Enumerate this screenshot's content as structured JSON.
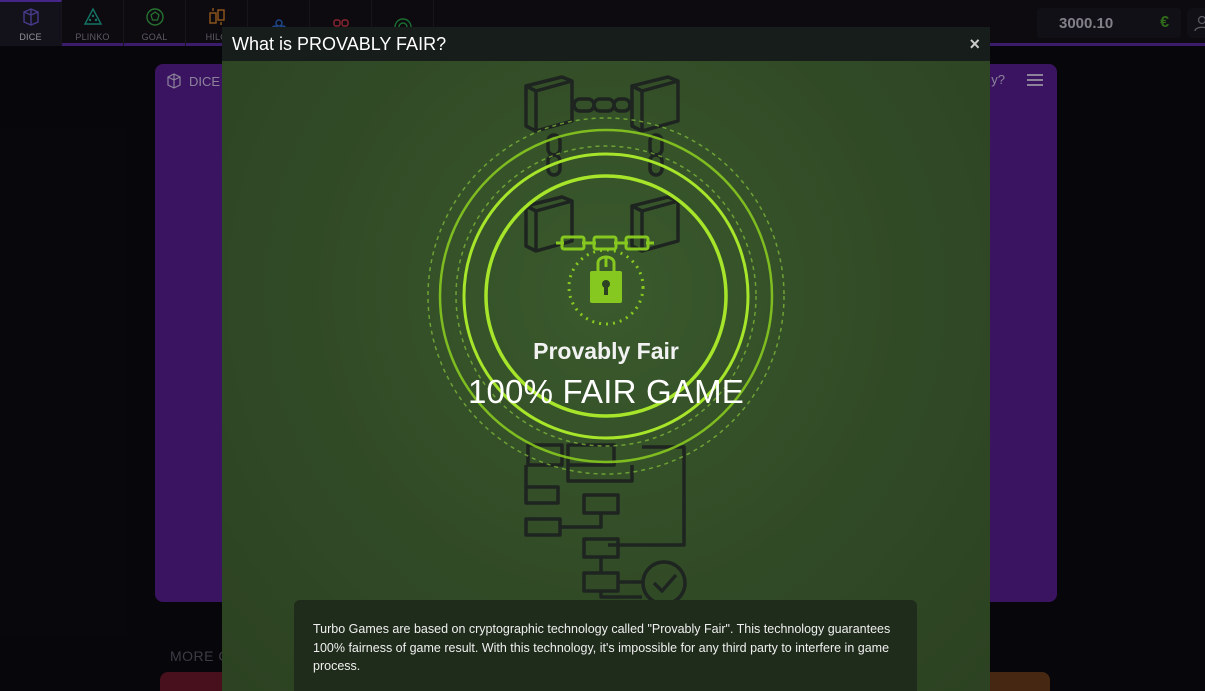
{
  "nav": {
    "items": [
      {
        "label": "DICE",
        "icon": "dice-icon",
        "color": "#6b5bd6",
        "active": true
      },
      {
        "label": "PLINKO",
        "icon": "plinko-icon",
        "color": "#1fb39a",
        "active": false
      },
      {
        "label": "GOAL",
        "icon": "goal-icon",
        "color": "#3bb04a",
        "active": false
      },
      {
        "label": "HILO",
        "icon": "hilo-icon",
        "color": "#e0862a",
        "active": false
      },
      {
        "label": "",
        "icon": "stars-icon",
        "color": "#2f6fd6",
        "active": false
      },
      {
        "label": "",
        "icon": "clover-icon",
        "color": "#d63a4a",
        "active": false
      },
      {
        "label": "",
        "icon": "target-icon",
        "color": "#2aa84a",
        "active": false
      }
    ]
  },
  "wallet": {
    "balance": "3000.10",
    "currency": "€"
  },
  "game_panel": {
    "title": "DICE",
    "howtoplay_fragment": "y?"
  },
  "more_label": "MORE G",
  "modal": {
    "title": "What is PROVABLY FAIR?",
    "close_icon": "×",
    "heading": "Provably Fair",
    "subheading": "100% FAIR GAME",
    "description": "Turbo Games are based on cryptographic technology called \"Provably Fair\". This technology guarantees 100% fairness of game result. With this technology, it's impossible for any third party to interfere in game process."
  },
  "colors": {
    "accent_green": "#8ccf1e",
    "nav_underline": "#5b2ca6",
    "panel_purple": "#5a1f95"
  }
}
